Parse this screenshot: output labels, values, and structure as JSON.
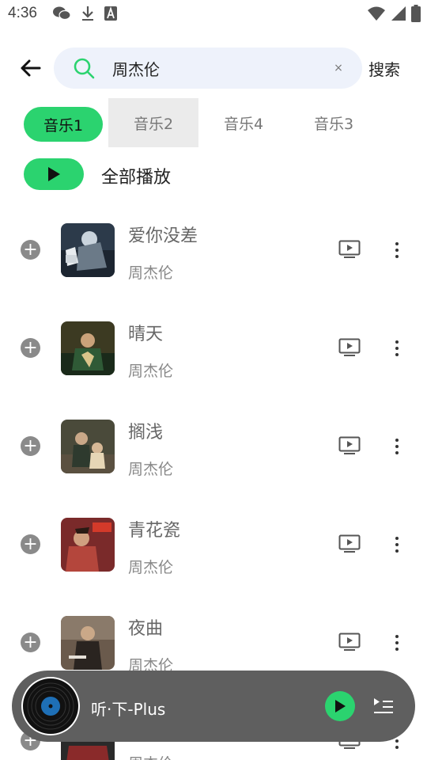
{
  "status_bar": {
    "time": "4:36",
    "left_icons": [
      "wechat-icon",
      "download-icon",
      "a-icon"
    ],
    "right_icons": [
      "wifi-icon",
      "signal-icon",
      "battery-icon"
    ]
  },
  "search": {
    "query": "周杰伦",
    "clear_label": "×",
    "submit_label": "搜索"
  },
  "tabs": [
    {
      "label": "音乐1",
      "active": true
    },
    {
      "label": "音乐2",
      "active": false
    },
    {
      "label": "音乐4",
      "active": false
    },
    {
      "label": "音乐3",
      "active": false
    }
  ],
  "play_all_label": "全部播放",
  "songs": [
    {
      "title": "爱你没差",
      "artist": "周杰伦"
    },
    {
      "title": "晴天",
      "artist": "周杰伦"
    },
    {
      "title": "搁浅",
      "artist": "周杰伦"
    },
    {
      "title": "青花瓷",
      "artist": "周杰伦"
    },
    {
      "title": "夜曲",
      "artist": "周杰伦"
    },
    {
      "title": "",
      "artist": "周杰伦"
    }
  ],
  "mini_player": {
    "title": "听·下-Plus"
  },
  "colors": {
    "accent": "#2bd36f",
    "player_bg": "#5f5f5f"
  }
}
